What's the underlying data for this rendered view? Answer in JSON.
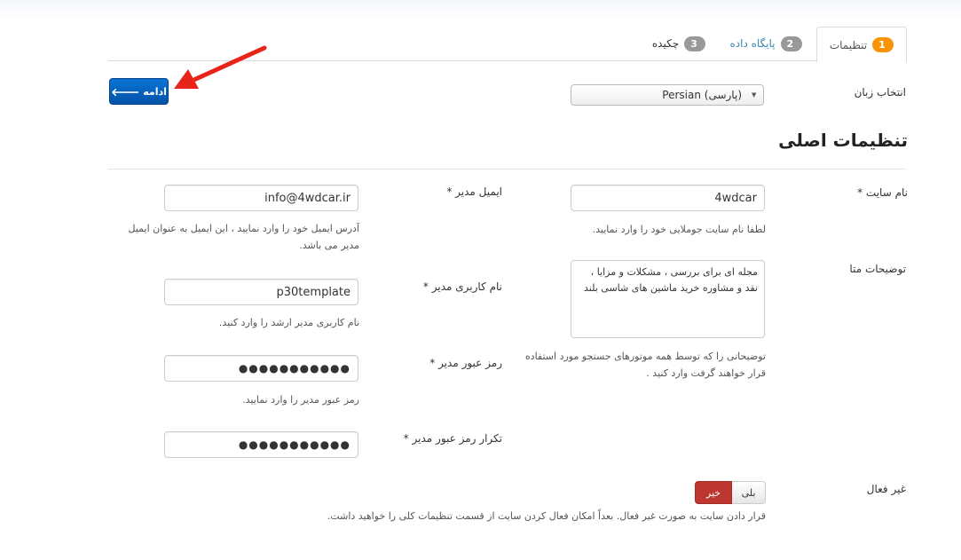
{
  "tabs": [
    {
      "number": "1",
      "label": "تنظیمات"
    },
    {
      "number": "2",
      "label": "پایگاه داده"
    },
    {
      "number": "3",
      "label": "چکیده"
    }
  ],
  "next_button": {
    "label": "ادامه"
  },
  "language": {
    "label": "انتخاب زبان",
    "selected": "Persian (پارسی)"
  },
  "section_title": "تنظیمات اصلی",
  "site_name": {
    "label": "نام سایت *",
    "value": "4wdcar",
    "help": "لطفا نام سایت جوملایی خود را وارد نمایید."
  },
  "meta_description": {
    "label": "توضیحات متا",
    "line1": "مجله ای برای بررسی ، مشکلات و مزایا ،",
    "line2": "نقد و مشاوره خرید ماشین های شاسی بلند",
    "help_line1": "توضیحاتی را که توسط همه موتورهای جستجو مورد استفاده",
    "help_line2": "قرار خواهند گرفت وارد کنید ."
  },
  "admin_email": {
    "label": "ایمیل مدیر *",
    "value": "info@4wdcar.ir",
    "help_line1": "آدرس ایمیل خود را وارد نمایید ، این ایمیل به عنوان ایمیل",
    "help_line2": "مدیر می باشد."
  },
  "admin_username": {
    "label": "نام کاربری مدیر *",
    "value": "p30template",
    "help": "نام کاربری مدیر ارشد را وارد کنید."
  },
  "admin_password": {
    "label": "رمز عبور مدیر *",
    "value": "●●●●●●●●●●●",
    "help": "رمز عبور مدیر را وارد نمایید."
  },
  "admin_password_confirm": {
    "label": "تکرار رمز عبور مدیر *",
    "value": "●●●●●●●●●●●"
  },
  "offline": {
    "label": "غیر فعال",
    "yes": "بلی",
    "no": "خیر",
    "help": "قرار دادن سایت به صورت غیر فعال. بعداً امکان فعال کردن سایت از قسمت تنظیمات کلی را خواهید داشت."
  },
  "colors": {
    "primary": "#0a74d5",
    "badge_active": "#f89406",
    "toggle_active": "#bd362f",
    "arrow": "#e8231a"
  }
}
